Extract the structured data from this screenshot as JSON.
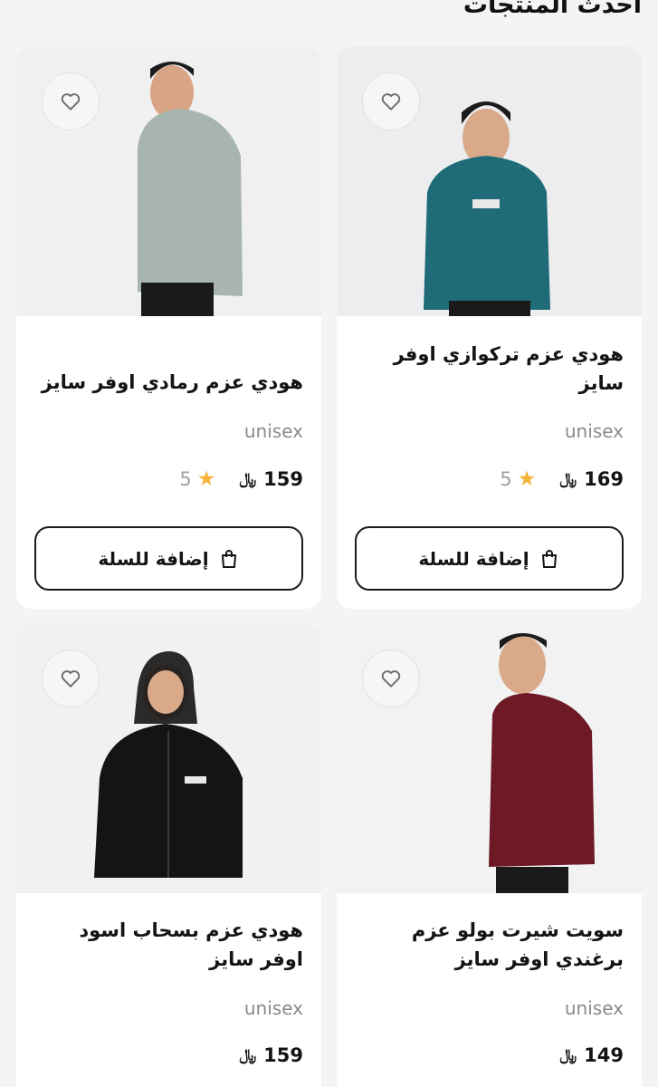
{
  "section": {
    "title": "احدث المنتجات"
  },
  "products": [
    {
      "name": "هودي عزم تركوازي اوفر سايز",
      "tag": "unisex",
      "price": "169",
      "currency": "﷼",
      "rating": "5",
      "add_label": "إضافة للسلة",
      "garment_color": "#1f6b78"
    },
    {
      "name": "هودي عزم رمادي اوفر سايز",
      "tag": "unisex",
      "price": "159",
      "currency": "﷼",
      "rating": "5",
      "add_label": "إضافة للسلة",
      "garment_color": "#a7b5ae"
    },
    {
      "name": "سويت شيرت بولو عزم برغندي اوفر سايز",
      "tag": "unisex",
      "price": "149",
      "currency": "﷼",
      "garment_color": "#6e1a26"
    },
    {
      "name": "هودي عزم بسحاب اسود اوفر سايز",
      "tag": "unisex",
      "price": "159",
      "currency": "﷼",
      "garment_color": "#141414"
    }
  ],
  "icons": {
    "wishlist": "heart-outline-icon",
    "rating": "star-icon",
    "cart": "shopping-bag-icon"
  },
  "colors": {
    "star": "#f5b43a",
    "background": "#f4f4f6",
    "card": "#ffffff"
  }
}
